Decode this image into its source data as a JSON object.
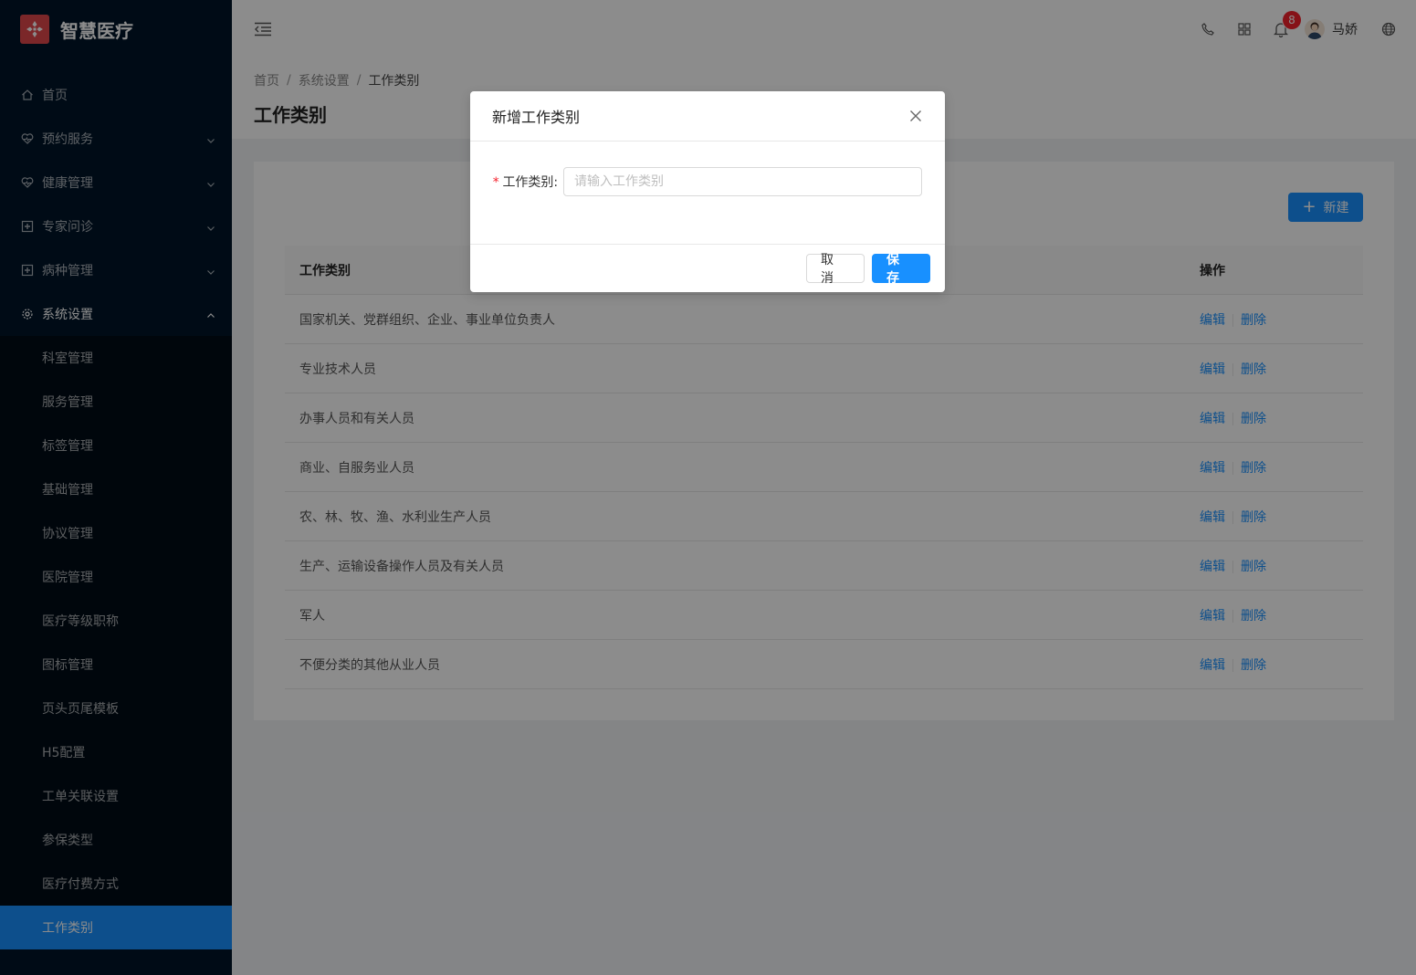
{
  "sidebar": {
    "app_title": "智慧医疗",
    "items": [
      {
        "label": "首页",
        "icon": "home-icon"
      },
      {
        "label": "预约服务",
        "icon": "heart-pulse-icon"
      },
      {
        "label": "健康管理",
        "icon": "heart-pulse-icon"
      },
      {
        "label": "专家问诊",
        "icon": "medical-box-icon"
      },
      {
        "label": "病种管理",
        "icon": "medical-box-icon"
      },
      {
        "label": "系统设置",
        "icon": "gear-icon"
      }
    ],
    "sub_items": [
      {
        "label": "科室管理"
      },
      {
        "label": "服务管理"
      },
      {
        "label": "标签管理"
      },
      {
        "label": "基础管理"
      },
      {
        "label": "协议管理"
      },
      {
        "label": "医院管理"
      },
      {
        "label": "医疗等级职称"
      },
      {
        "label": "图标管理"
      },
      {
        "label": "页头页尾模板"
      },
      {
        "label": "H5配置"
      },
      {
        "label": "工单关联设置"
      },
      {
        "label": "参保类型"
      },
      {
        "label": "医疗付费方式"
      },
      {
        "label": "工作类别"
      }
    ],
    "active_item": "工作类别",
    "colors": {
      "bg": "#001529",
      "active": "#1890ff"
    }
  },
  "header": {
    "notification_count": "8",
    "user_name": "马娇"
  },
  "breadcrumb": [
    "首页",
    "系统设置",
    "工作类别"
  ],
  "breadcrumb_sep": "/",
  "page_title": "工作类别",
  "toolbar": {
    "new_label": "新建"
  },
  "table": {
    "columns": [
      "工作类别",
      "操作"
    ],
    "rows": [
      {
        "name": "国家机关、党群组织、企业、事业单位负责人"
      },
      {
        "name": "专业技术人员"
      },
      {
        "name": "办事人员和有关人员"
      },
      {
        "name": "商业、自服务业人员"
      },
      {
        "name": "农、林、牧、渔、水利业生产人员"
      },
      {
        "name": "生产、运输设备操作人员及有关人员"
      },
      {
        "name": "军人"
      },
      {
        "name": "不便分类的其他从业人员"
      }
    ],
    "edit_label": "编辑",
    "delete_label": "删除"
  },
  "modal": {
    "title": "新增工作类别",
    "field_label": "工作类别:",
    "field_value": "",
    "field_placeholder": "请输入工作类别",
    "required_mark": "*",
    "cancel_label": "取 消",
    "save_label": "保 存"
  }
}
